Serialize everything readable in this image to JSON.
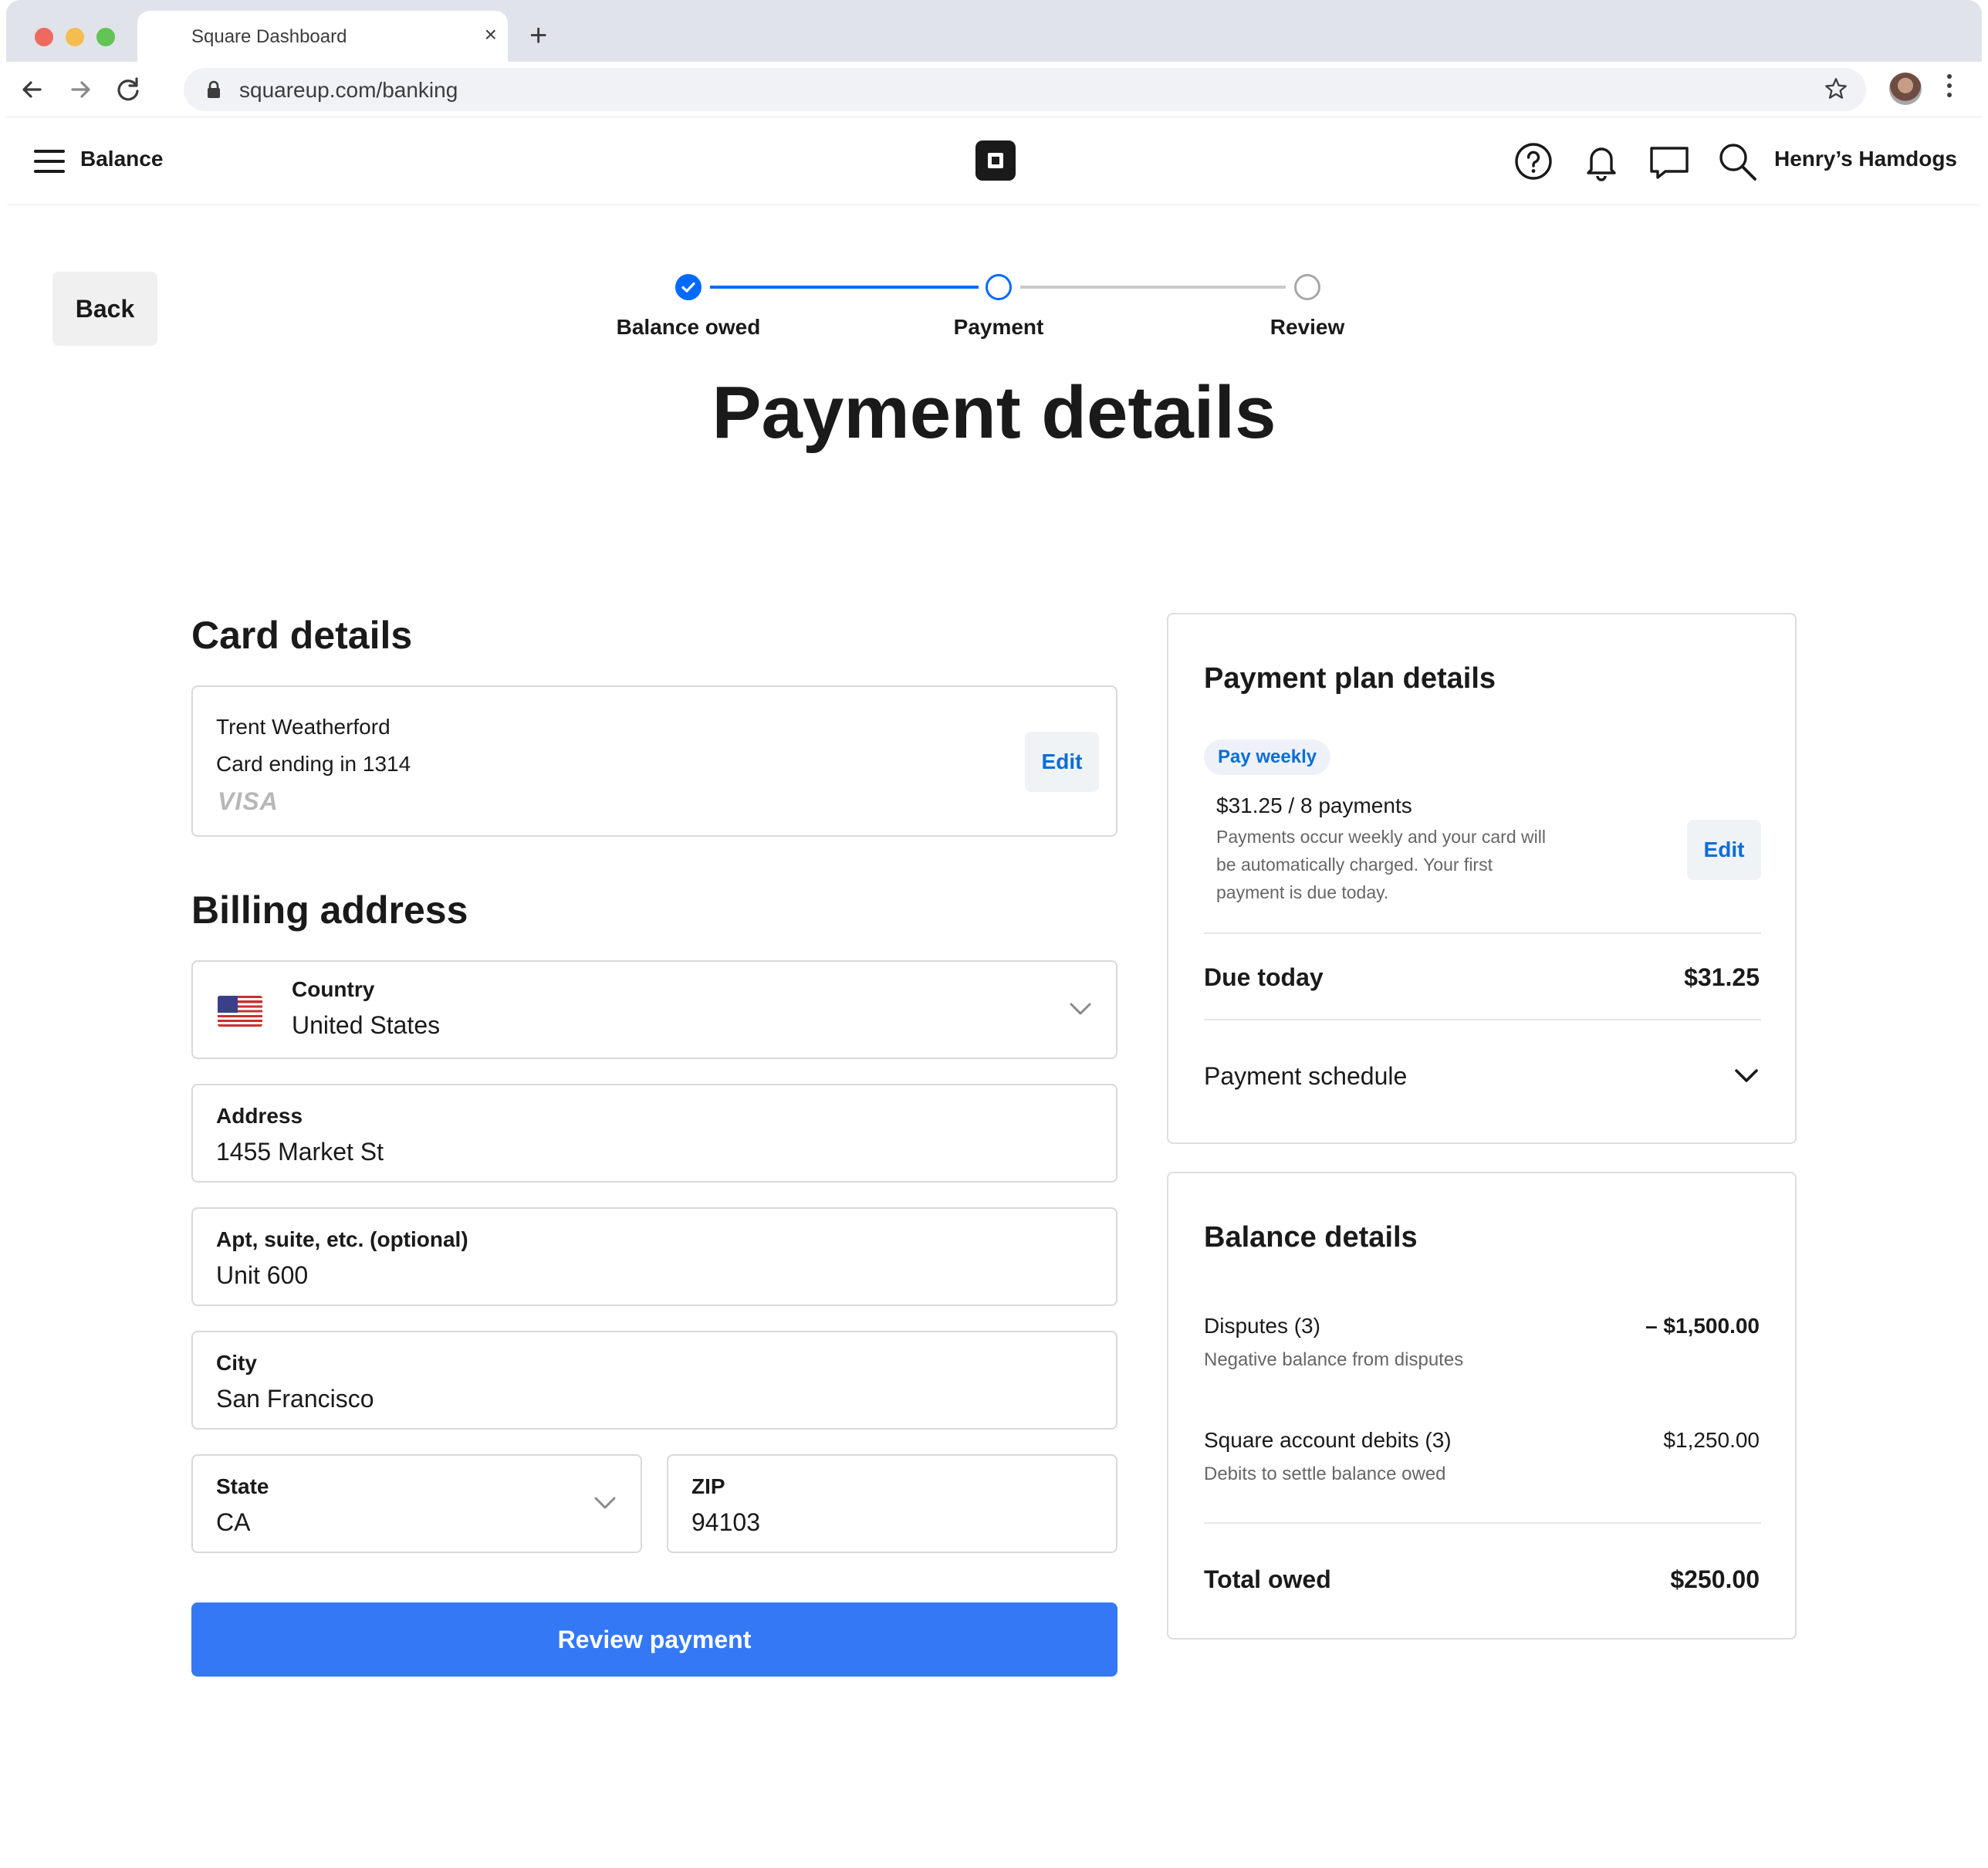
{
  "browser": {
    "tab_title": "Square Dashboard",
    "tab_close": "×",
    "new_tab": "+",
    "url": "squareup.com/banking"
  },
  "header": {
    "title": "Balance",
    "merchant": "Henry’s Hamdogs"
  },
  "back_label": "Back",
  "stepper": {
    "steps": [
      {
        "label": "Balance owed",
        "state": "complete"
      },
      {
        "label": "Payment",
        "state": "current"
      },
      {
        "label": "Review",
        "state": "upcoming"
      }
    ]
  },
  "page_title": "Payment details",
  "card_details": {
    "heading": "Card details",
    "cardholder": "Trent Weatherford",
    "card_ending": "Card ending in 1314",
    "brand": "VISA",
    "edit_label": "Edit"
  },
  "billing": {
    "heading": "Billing address",
    "country": {
      "label": "Country",
      "value": "United States"
    },
    "address": {
      "label": "Address",
      "value": "1455 Market St"
    },
    "apt": {
      "label": "Apt, suite, etc. (optional)",
      "value": "Unit 600"
    },
    "city": {
      "label": "City",
      "value": "San Francisco"
    },
    "state": {
      "label": "State",
      "value": "CA"
    },
    "zip": {
      "label": "ZIP",
      "value": "94103"
    }
  },
  "review_button": "Review payment",
  "plan": {
    "heading": "Payment plan details",
    "frequency_badge": "Pay weekly",
    "amount": "$31.25 / 8 payments",
    "description": "Payments occur weekly and your card will be automatically charged. Your first payment is due today.",
    "edit_label": "Edit",
    "due_today_label": "Due today",
    "due_today_value": "$31.25",
    "schedule_label": "Payment schedule"
  },
  "balance": {
    "heading": "Balance details",
    "disputes_label": "Disputes (3)",
    "disputes_sub": "Negative balance from disputes",
    "disputes_value": "– $1,500.00",
    "debits_label": "Square account debits (3)",
    "debits_sub": "Debits to settle balance owed",
    "debits_value": "$1,250.00",
    "total_label": "Total owed",
    "total_value": "$250.00"
  },
  "colors": {
    "accent": "#006aff",
    "button": "#3478f6",
    "link": "#0a6dd8"
  }
}
